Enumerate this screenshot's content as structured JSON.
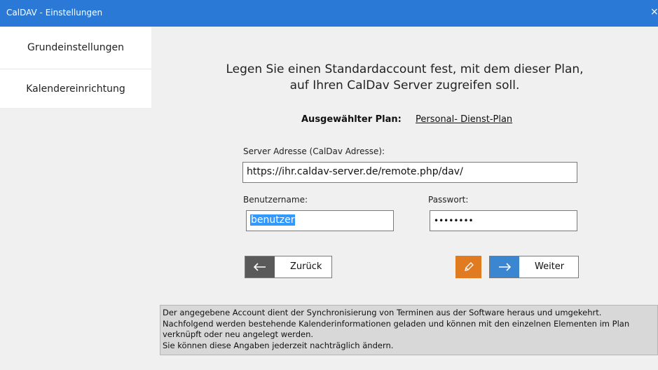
{
  "window": {
    "title": "CalDAV - Einstellungen",
    "close_glyph": "×"
  },
  "sidebar": {
    "items": [
      {
        "label": "Grundeinstellungen"
      },
      {
        "label": "Kalendereinrichtung"
      }
    ]
  },
  "main": {
    "heading_line1": "Legen Sie einen Standardaccount fest, mit dem dieser Plan,",
    "heading_line2": "auf Ihren CalDav Server zugreifen soll.",
    "plan_label": "Ausgewählter Plan:",
    "plan_value": "Personal-  Dienst-Plan",
    "server_label": "Server Adresse (CalDav Adresse):",
    "server_value": "https://ihr.caldav-server.de/remote.php/dav/",
    "username_label": "Benutzername:",
    "username_value": "benutzer",
    "password_label": "Passwort:",
    "password_value": "••••••••",
    "back_label": "Zurück",
    "next_label": "Weiter",
    "info_lines": [
      "Der angegebene Account dient der Synchronisierung von Terminen aus der Software heraus und umgekehrt.",
      "Nachfolgend werden bestehende Kalenderinformationen geladen und können mit den einzelnen Elementen im Plan",
      "verknüpft oder neu angelegt werden.",
      "Sie können diese Angaben jederzeit nachträglich ändern."
    ]
  },
  "colors": {
    "titlebar": "#2b79d6",
    "back_icon_bg": "#5a5a5a",
    "edit_button_bg": "#e07b22",
    "next_icon_bg": "#3b86d0",
    "selection": "#3399ff"
  },
  "icons": {
    "back": "arrow-left-icon",
    "next": "arrow-right-icon",
    "edit": "pencil-icon",
    "close": "close-icon"
  }
}
